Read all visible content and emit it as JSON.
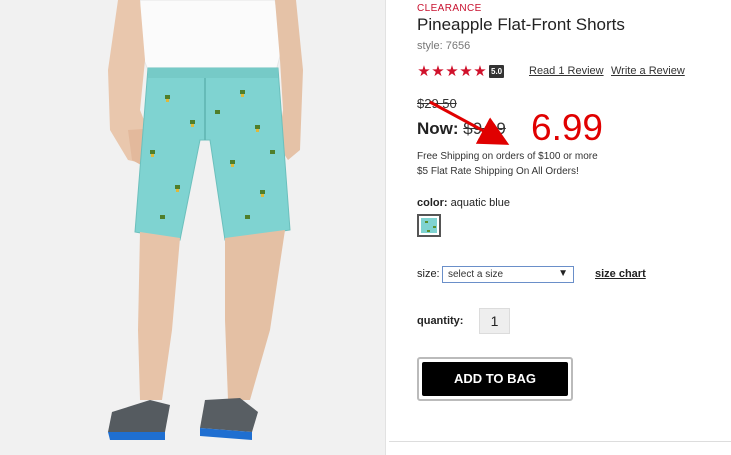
{
  "product": {
    "badge": "CLEARANCE",
    "title": "Pineapple Flat-Front Shorts",
    "style": "style: 7656",
    "rating": {
      "stars": 5,
      "score": "5.0",
      "read_label": "Read 1 Review",
      "write_label": "Write a Review"
    },
    "price": {
      "original": "$29.50",
      "now_label": "Now:",
      "now_amount": "$9.99"
    },
    "shipping": [
      "Free Shipping on orders of $100 or more",
      "$5 Flat Rate Shipping On All Orders!"
    ],
    "color": {
      "label": "color:",
      "value": "aquatic blue",
      "swatch_hex": "#7fd3d1"
    },
    "size": {
      "label": "size:",
      "selected": "select a size",
      "chart_label": "size chart"
    },
    "quantity": {
      "label": "quantity:",
      "value": "1"
    },
    "add_to_bag_label": "ADD TO BAG"
  },
  "annotation": {
    "text": "6.99",
    "color": "#e00000"
  },
  "colors": {
    "accent_red": "#c8102e",
    "short_color": "#7fd3d1",
    "button_bg": "#000000"
  }
}
